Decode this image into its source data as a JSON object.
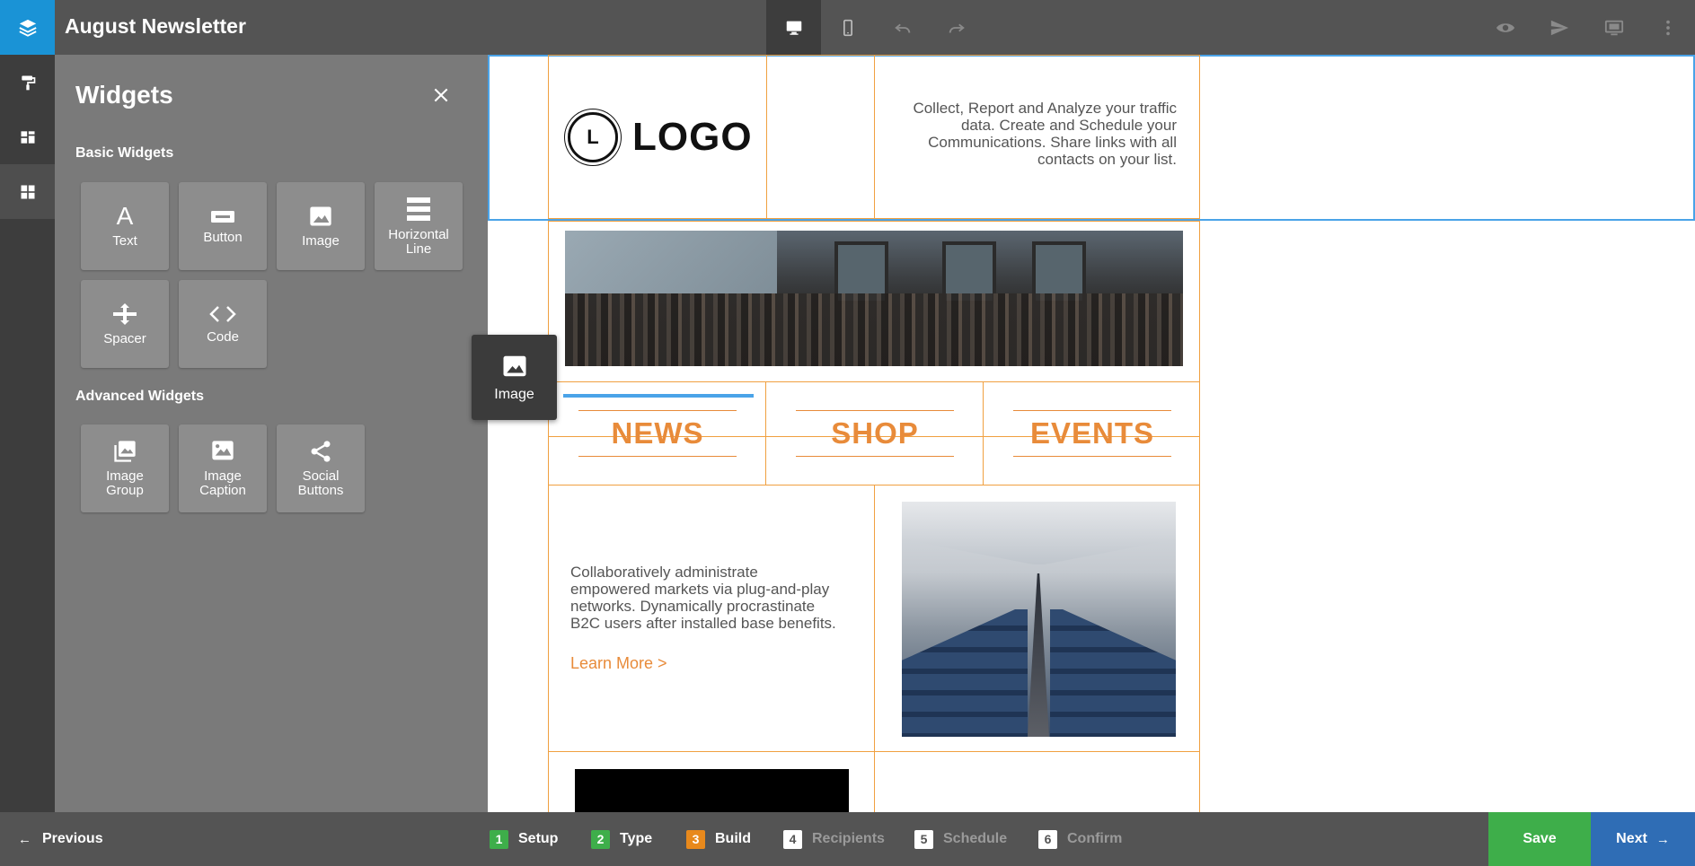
{
  "app": {
    "title": "August Newsletter"
  },
  "colors": {
    "brand": "#1a93d6",
    "accent": "#e88b3a",
    "selection": "#4aa3e8",
    "save": "#3eae4a",
    "next": "#2f6db5",
    "step_done": "#3eae4a",
    "step_current": "#e8891c"
  },
  "toolbar": {
    "left_icon": "layers-icon",
    "center": [
      "desktop-icon",
      "mobile-icon",
      "undo-icon",
      "redo-icon"
    ],
    "right": [
      "eye-icon",
      "send-icon",
      "monitor-icon",
      "more-vertical-icon"
    ]
  },
  "rail": [
    "paint-roller-icon",
    "layout-icon",
    "widgets-icon"
  ],
  "panel": {
    "title": "Widgets",
    "basic_title": "Basic Widgets",
    "basic": [
      "Text",
      "Button",
      "Image",
      "Horizontal\nLine",
      "Spacer",
      "Code"
    ],
    "advanced_title": "Advanced Widgets",
    "advanced": [
      "Image\nGroup",
      "Image\nCaption",
      "Social\nButtons"
    ]
  },
  "drag_ghost": {
    "label": "Image"
  },
  "email": {
    "logo_letter": "L",
    "logo_text": "LOGO",
    "header_text": "Collect, Report and Analyze your traffic data. Create and Schedule your Communications. Share links with all contacts on your list.",
    "nav": [
      "NEWS",
      "SHOP",
      "EVENTS"
    ],
    "body_text": "Collaboratively administrate empowered markets via plug-and-play networks. Dynamically procrastinate B2C users after installed base benefits.",
    "learn_more": "Learn More >"
  },
  "footer": {
    "previous": "Previous",
    "steps": [
      {
        "num": "1",
        "label": "Setup",
        "state": "done"
      },
      {
        "num": "2",
        "label": "Type",
        "state": "done"
      },
      {
        "num": "3",
        "label": "Build",
        "state": "current"
      },
      {
        "num": "4",
        "label": "Recipients",
        "state": "upcoming"
      },
      {
        "num": "5",
        "label": "Schedule",
        "state": "upcoming"
      },
      {
        "num": "6",
        "label": "Confirm",
        "state": "upcoming"
      }
    ],
    "save": "Save",
    "next": "Next"
  }
}
